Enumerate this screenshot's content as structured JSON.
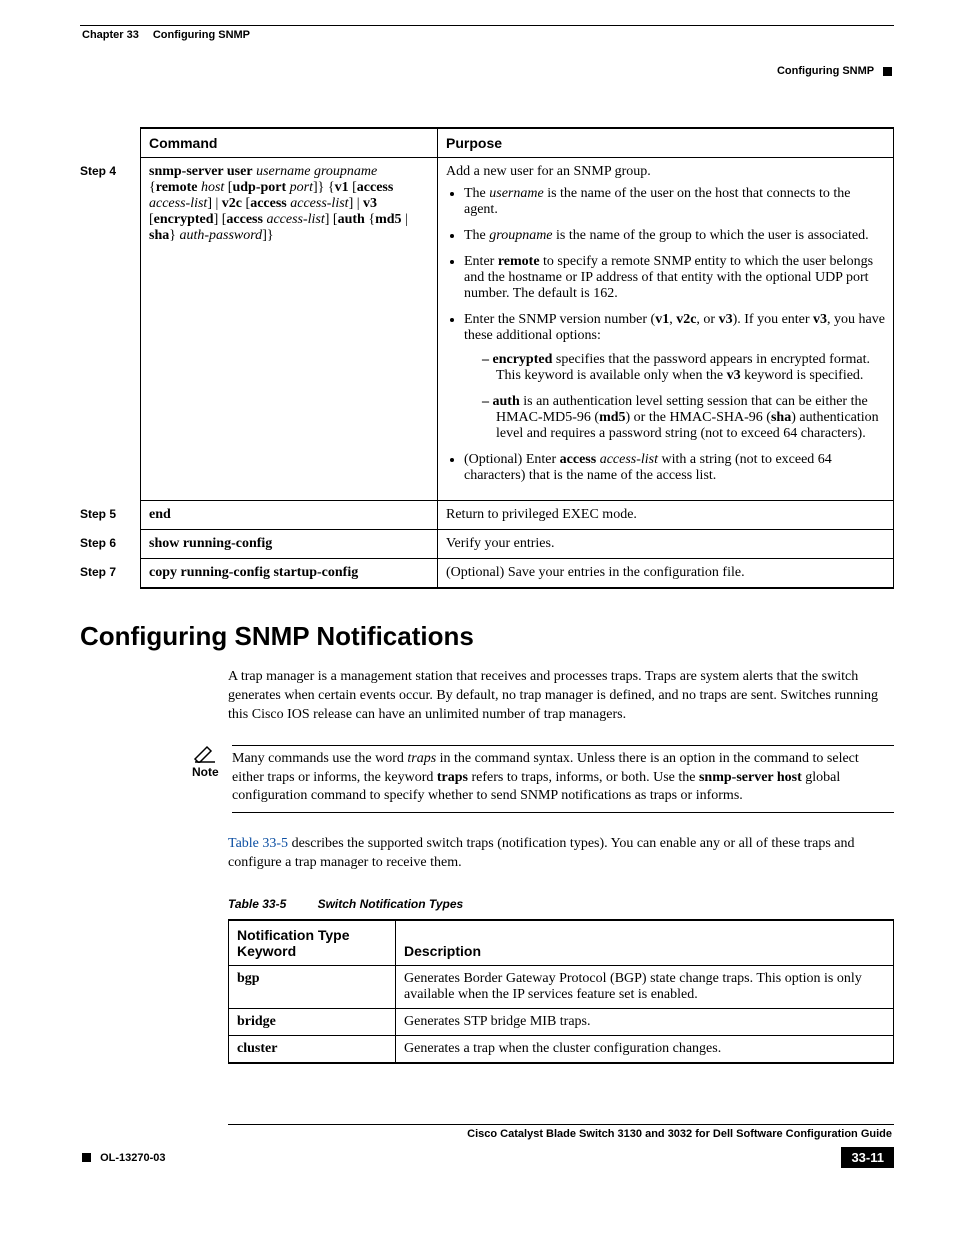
{
  "header": {
    "chapter": "Chapter 33",
    "chapter_title": "Configuring SNMP",
    "right_section": "Configuring SNMP"
  },
  "cmd_table": {
    "headers": {
      "command": "Command",
      "purpose": "Purpose"
    },
    "rows": [
      {
        "step": "Step 4",
        "command_html": "<span class='b'>snmp-server user</span> <span class='i'>username groupname</span> {<span class='b'>remote</span> <span class='i'>host</span> [<span class='b'>udp-port</span> <span class='i'>port</span>]} {<span class='b'>v1</span> [<span class='b'>access</span> <span class='i'>access-list</span>] | <span class='b'>v2c</span> [<span class='b'>access</span> <span class='i'>access-list</span>] | <span class='b'>v3</span> [<span class='b'>encrypted</span>] [<span class='b'>access</span> <span class='i'>access-list</span>] [<span class='b'>auth</span> {<span class='b'>md5</span> | <span class='b'>sha</span>} <span class='i'>auth-password</span>]}",
        "purpose_intro": "Add a new user for an SNMP group.",
        "purpose_bullets": [
          "The <span class='i'>username</span> is the name of the user on the host that connects to the agent.",
          "The <span class='i'>groupname</span> is the name of the group to which the user is associated.",
          "Enter <span class='b'>remote</span> to specify a remote SNMP entity to which the user belongs and the hostname or IP address of that entity with the optional UDP port number. The default is 162.",
          "Enter the SNMP version number (<span class='b'>v1</span>, <span class='b'>v2c</span>, or <span class='b'>v3</span>). If you enter <span class='b'>v3</span>, you have these additional options:"
        ],
        "sub_bullets": [
          "<span class='b'>encrypted</span> specifies that the password appears in encrypted format. This keyword is available only when the <span class='b'>v3</span> keyword is specified.",
          "<span class='b'>auth</span> is an authentication level setting session that can be either the HMAC-MD5-96 (<span class='b'>md5</span>) or the HMAC-SHA-96 (<span class='b'>sha</span>) authentication level and requires a password string (not to exceed 64 characters)."
        ],
        "last_bullet": "(Optional) Enter <span class='b'>access</span> <span class='i'>access-list</span> with a string (not to exceed 64 characters) that is the name of the access list."
      },
      {
        "step": "Step 5",
        "command_html": "<span class='b'>end</span>",
        "purpose_plain": "Return to privileged EXEC mode."
      },
      {
        "step": "Step 6",
        "command_html": "<span class='b'>show running-config</span>",
        "purpose_plain": "Verify your entries."
      },
      {
        "step": "Step 7",
        "command_html": "<span class='b'>copy running-config startup-config</span>",
        "purpose_plain": "(Optional) Save your entries in the configuration file."
      }
    ]
  },
  "section_heading": "Configuring SNMP Notifications",
  "para1": "A trap manager is a management station that receives and processes traps. Traps are system alerts that the switch generates when certain events occur. By default, no trap manager is defined, and no traps are sent. Switches running this Cisco IOS release can have an unlimited number of trap managers.",
  "note": {
    "label": "Note",
    "text_html": "Many commands use the word <span class='i'>traps</span> in the command syntax. Unless there is an option in the command to select either traps or informs, the keyword <span class='b'>traps</span> refers to traps, informs, or both. Use the <span class='b'>snmp-server host</span> global configuration command to specify whether to send SNMP notifications as traps or informs."
  },
  "para2_html": "<span class='link'>Table 33-5</span> describes the supported switch traps (notification types). You can enable any or all of these traps and configure a trap manager to receive them.",
  "notif_table": {
    "caption_num": "Table 33-5",
    "caption_title": "Switch Notification Types",
    "headers": {
      "keyword": "Notification Type Keyword",
      "description": "Description"
    },
    "rows": [
      {
        "keyword": "bgp",
        "description": "Generates Border Gateway Protocol (BGP) state change traps. This option is only available when the IP services feature set is enabled."
      },
      {
        "keyword": "bridge",
        "description": "Generates STP bridge MIB traps."
      },
      {
        "keyword": "cluster",
        "description": "Generates a trap when the cluster configuration changes."
      }
    ]
  },
  "footer": {
    "book_title": "Cisco Catalyst Blade Switch 3130 and 3032 for Dell Software Configuration Guide",
    "doc_id": "OL-13270-03",
    "page_num": "33-11"
  }
}
